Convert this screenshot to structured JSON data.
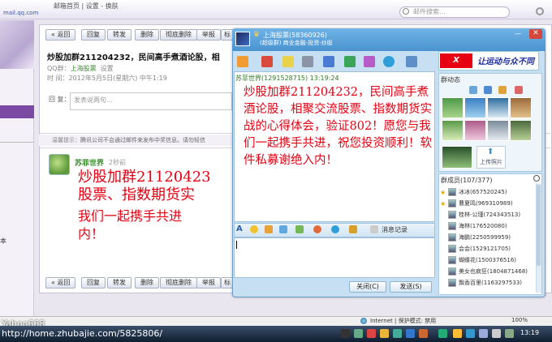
{
  "mail_header": {
    "logo": "",
    "logo_sub": "mail.qq.com",
    "links": "邮箱首页 | 设置 - 换肤",
    "search_placeholder": "邮件搜索..."
  },
  "left_column": {
    "tail_text": "本"
  },
  "mail_toolbar": {
    "back": "« 返回",
    "reply": "回复",
    "forward": "转发",
    "delete": "删除",
    "delete_forever": "彻底删除",
    "report": "举报",
    "mark": "标"
  },
  "mail": {
    "subject": "炒股加群211204232，民间高手煮酒论股，相",
    "sender_prefix": "QQ群：",
    "sender_name": "上海股票",
    "sender_action": "设置",
    "time_prefix": "时  间：",
    "time": "2012年5月5日(星期六) 中午1:19",
    "reply_label": "回  复：",
    "reply_placeholder": "发表说两句...",
    "warn_label": "温馨提示：",
    "warn_text": "腾讯公司不会通过邮件来发布中奖信息。请勿轻信",
    "message_sender": "苏菲世界",
    "message_time": "2秒前",
    "body_line1": "炒股加群21120423",
    "body_line2": "股票、指数期货实",
    "body_line3": "我们一起携手共进",
    "body_line4": "内！"
  },
  "qq": {
    "group_name": "上海股票(58360926)",
    "group_desc": "(超级群) 商业金融-投资-炒股",
    "ad_x": "X",
    "ad_text": "让运动与众不同",
    "chat_sender": "苏菲世界(1291528715)  13:19:24",
    "chat_message": "炒股加群211204232，民间高手煮酒论股，相聚交流股票、指数期货实战的心得体会，验证802！愿您与我们一起携手共进，祝您投资顺利！软件私募谢绝入内！",
    "font_a": "A",
    "history": "消息记录",
    "close_button": "关闭(C)",
    "send_button": "发送(S)",
    "side_title": "群动态",
    "upload_photo": "上传照片",
    "members_title": "群成员(107/377)",
    "members": [
      "冰冰(657520245)",
      "曹夏鸣(969310989)",
      "桂林-公瑾(724343513)",
      "海林(176520080)",
      "海鹏(2250599959)",
      "会会(1529121705)",
      "蝴蝶花(1500376516)",
      "美女也疯狂(1804871468)",
      "飘香百里(1163297533)"
    ]
  },
  "statusbar": {
    "zone": "Internet | 保护模式: 禁用",
    "zoom": "100%"
  },
  "taskbar": {
    "overlay_name": "Yahoo668",
    "url": "http://home.zhubajie.com/5825806/",
    "clock": "13:19"
  }
}
